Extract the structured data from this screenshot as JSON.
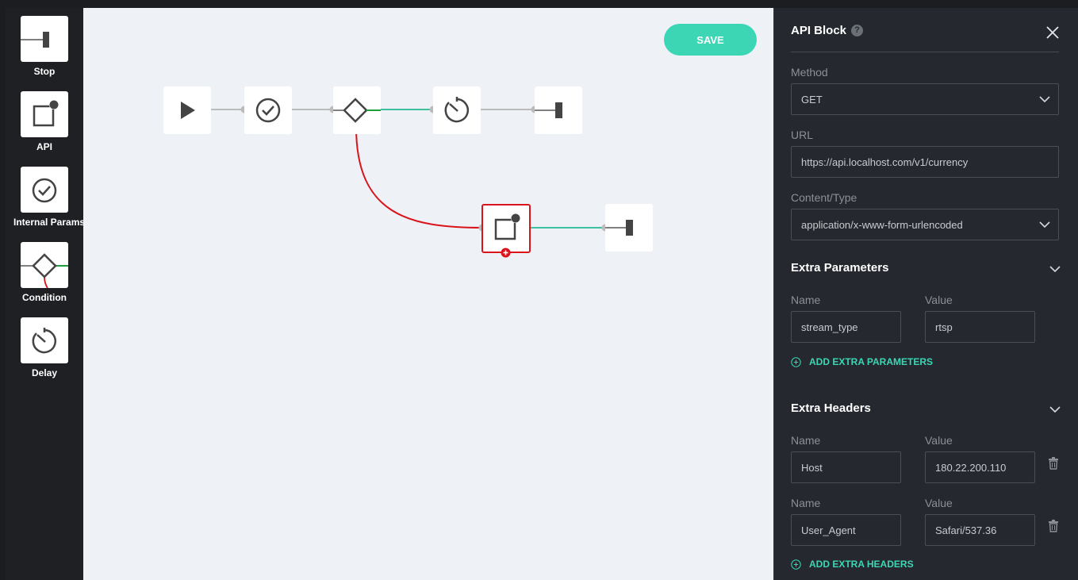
{
  "palette": {
    "items": [
      {
        "label": "Stop",
        "icon": "stop-icon"
      },
      {
        "label": "API",
        "icon": "api-icon"
      },
      {
        "label": "Internal Params",
        "icon": "check-circle-icon"
      },
      {
        "label": "Condition",
        "icon": "diamond-icon"
      },
      {
        "label": "Delay",
        "icon": "timer-icon"
      }
    ]
  },
  "canvas": {
    "save_label": "SAVE",
    "nodes": [
      "play-icon",
      "check-circle-icon",
      "diamond-icon",
      "timer-icon",
      "stop-icon",
      "api-icon",
      "stop-icon"
    ]
  },
  "panel": {
    "title": "API Block",
    "help_icon": "?",
    "method": {
      "label": "Method",
      "value": "GET"
    },
    "url": {
      "label": "URL",
      "value": "https://api.localhost.com/v1/currency"
    },
    "content_type": {
      "label": "Content/Type",
      "value": "application/x-www-form-urlencoded"
    },
    "extra_parameters": {
      "title": "Extra Parameters",
      "rows": [
        {
          "name_label": "Name",
          "value_label": "Value",
          "name": "stream_type",
          "value": "rtsp"
        }
      ],
      "add_label": "ADD EXTRA PARAMETERS"
    },
    "extra_headers": {
      "title": "Extra Headers",
      "rows": [
        {
          "name_label": "Name",
          "value_label": "Value",
          "name": "Host",
          "value": "180.22.200.110"
        },
        {
          "name_label": "Name",
          "value_label": "Value",
          "name": "User_Agent",
          "value": "Safari/537.36"
        }
      ],
      "add_label": "ADD EXTRA HEADERS"
    }
  },
  "colors": {
    "accent": "#3dd6b5",
    "error_edge": "#d9141b",
    "success_edge": "#1e9e3c",
    "panel_bg": "#25282e"
  }
}
